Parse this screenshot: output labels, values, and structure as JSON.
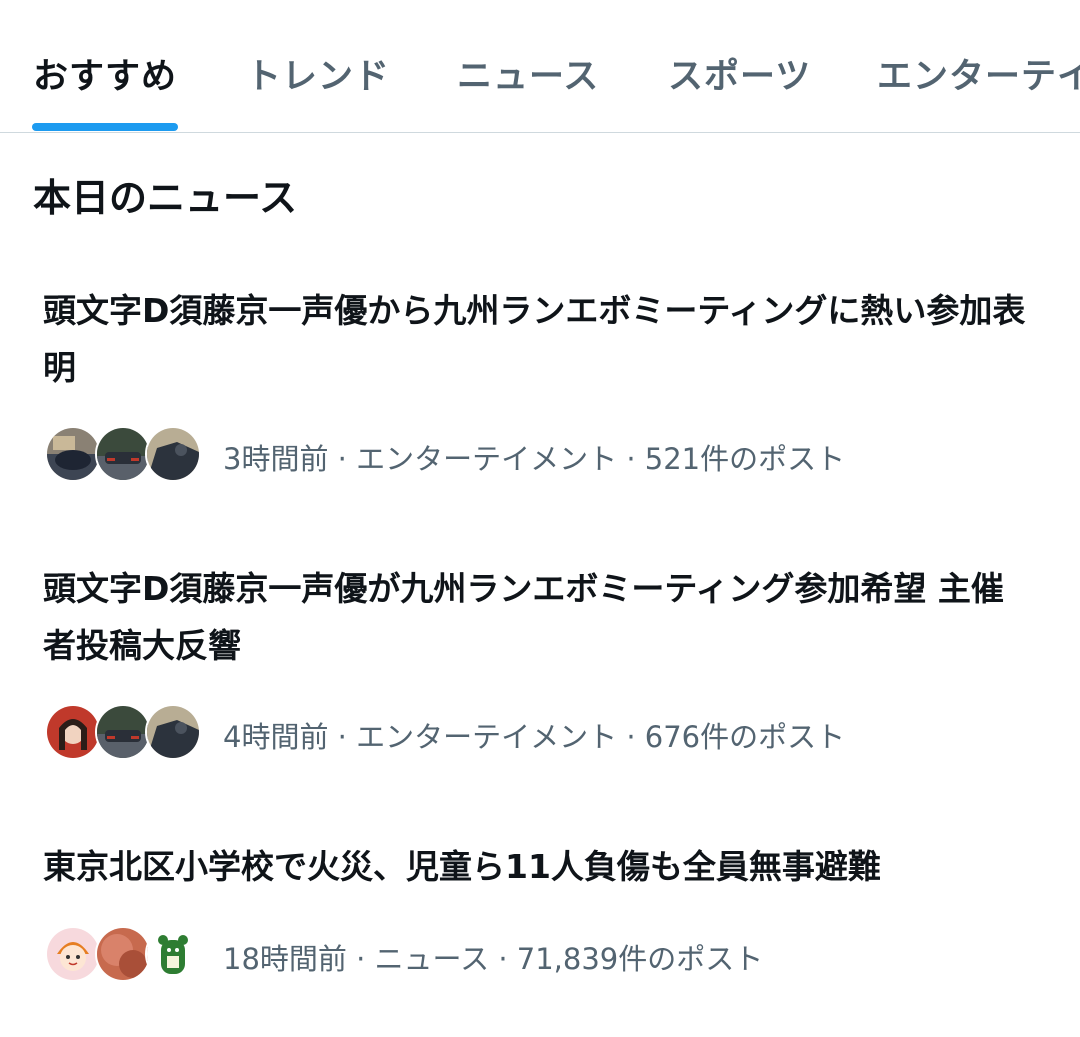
{
  "tabs": [
    {
      "label": "おすすめ",
      "active": true
    },
    {
      "label": "トレンド",
      "active": false
    },
    {
      "label": "ニュース",
      "active": false
    },
    {
      "label": "スポーツ",
      "active": false
    },
    {
      "label": "エンターテイ",
      "active": false
    }
  ],
  "accent_color": "#1d9bf0",
  "section": {
    "title": "本日のニュース"
  },
  "news": [
    {
      "headline": "頭文字D須藤京一声優から九州ランエボミーティングに熱い参加表明",
      "time": "3時間前",
      "category": "エンターテイメント",
      "posts": "521件のポスト",
      "meta": "3時間前 · エンターテイメント · 521件のポスト"
    },
    {
      "headline": "頭文字D須藤京一声優が九州ランエボミーティング参加希望 主催者投稿大反響",
      "time": "4時間前",
      "category": "エンターテイメント",
      "posts": "676件のポスト",
      "meta": "4時間前 · エンターテイメント · 676件のポスト"
    },
    {
      "headline": "東京北区小学校で火災、児童ら11人負傷も全員無事避難",
      "time": "18時間前",
      "category": "ニュース",
      "posts": "71,839件のポスト",
      "meta": "18時間前 · ニュース · 71,839件のポスト"
    }
  ]
}
